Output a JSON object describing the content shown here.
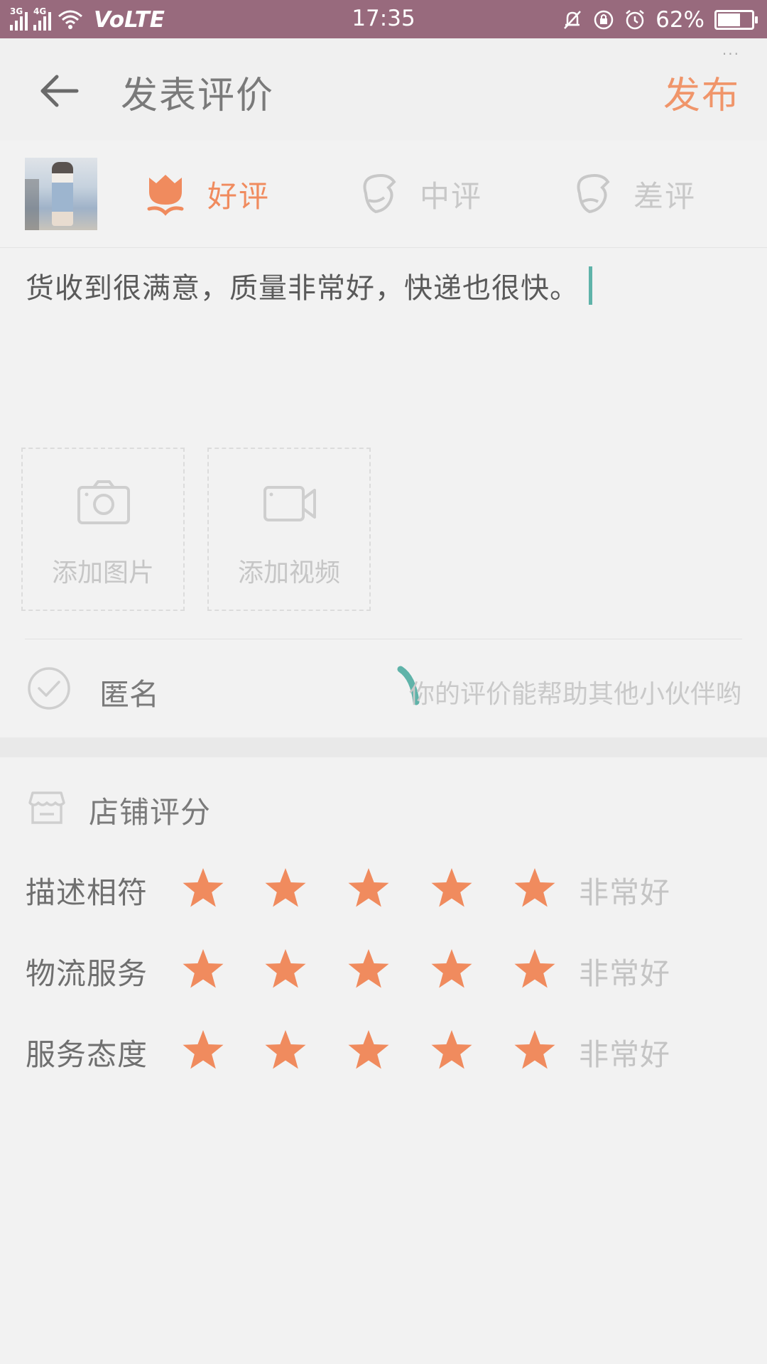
{
  "status_bar": {
    "network_1": "3G",
    "network_2": "4G",
    "volte": "VoLTE",
    "time": "17:35",
    "battery_percent": "62%",
    "battery_level": 0.62
  },
  "header": {
    "title": "发表评价",
    "publish_label": "发布",
    "more_indicator": "···"
  },
  "rating": {
    "options": [
      {
        "label": "好评",
        "selected": true
      },
      {
        "label": "中评",
        "selected": false
      },
      {
        "label": "差评",
        "selected": false
      }
    ]
  },
  "review": {
    "text": "货收到很满意，质量非常好，快递也很快。"
  },
  "uploads": {
    "photo_label": "添加图片",
    "video_label": "添加视频"
  },
  "anonymous": {
    "label": "匿名",
    "hint": "你的评价能帮助其他小伙伴哟"
  },
  "shop": {
    "title": "店铺评分",
    "rows": [
      {
        "category": "描述相符",
        "stars": 5,
        "verdict": "非常好"
      },
      {
        "category": "物流服务",
        "stars": 5,
        "verdict": "非常好"
      },
      {
        "category": "服务态度",
        "stars": 5,
        "verdict": "非常好"
      }
    ]
  },
  "colors": {
    "accent": "#f08b5e",
    "status_bar": "#986a7d",
    "caret": "#5fb3a9",
    "muted": "#c8c8c8"
  }
}
